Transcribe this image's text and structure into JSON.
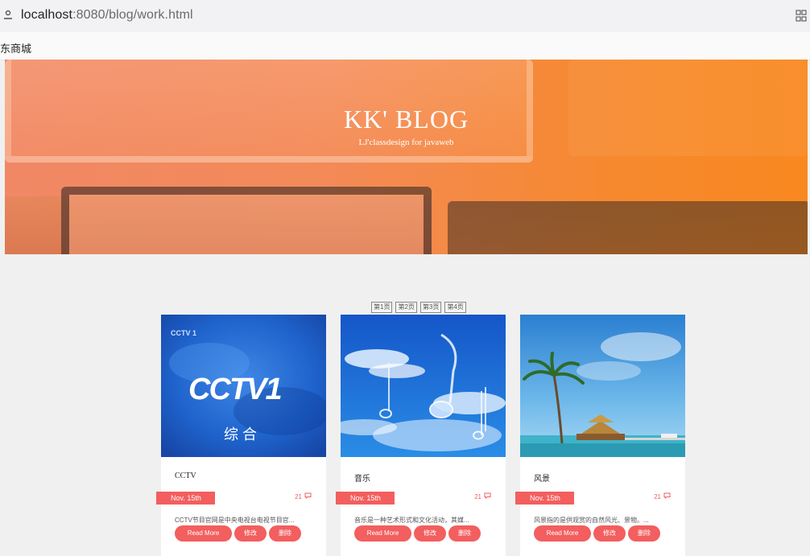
{
  "browser": {
    "url_host": "localhost",
    "url_rest": ":8080/blog/work.html",
    "bookmark": "东商城"
  },
  "hero": {
    "title": "KK' BLOG",
    "subtitle": "LJ'classdesign for javaweb"
  },
  "pagination": [
    "第1页",
    "第2页",
    "第3页",
    "第4页"
  ],
  "cards": [
    {
      "name": "CCTV",
      "date": "Nov. 15th",
      "comments": "21",
      "desc": "CCTV节目官网是中央电视台电视节目官...",
      "read_more": "Read More",
      "edit": "修改",
      "delete": "删除",
      "image_text_top": "CCTV 1",
      "image_text_main": "CCTV1",
      "image_text_sub": "综 合"
    },
    {
      "name": "音乐",
      "date": "Nov. 15th",
      "comments": "21",
      "desc": "音乐是一种艺术形式和文化活动，其媒...",
      "read_more": "Read More",
      "edit": "修改",
      "delete": "删除"
    },
    {
      "name": "风景",
      "date": "Nov. 15th",
      "comments": "21",
      "desc": "风景指的是供观赏的自然风光、景物。...",
      "read_more": "Read More",
      "edit": "修改",
      "delete": "删除"
    }
  ],
  "colors": {
    "accent": "#f35e5e",
    "hero_left": "#f08866",
    "hero_right": "#f9881f"
  }
}
